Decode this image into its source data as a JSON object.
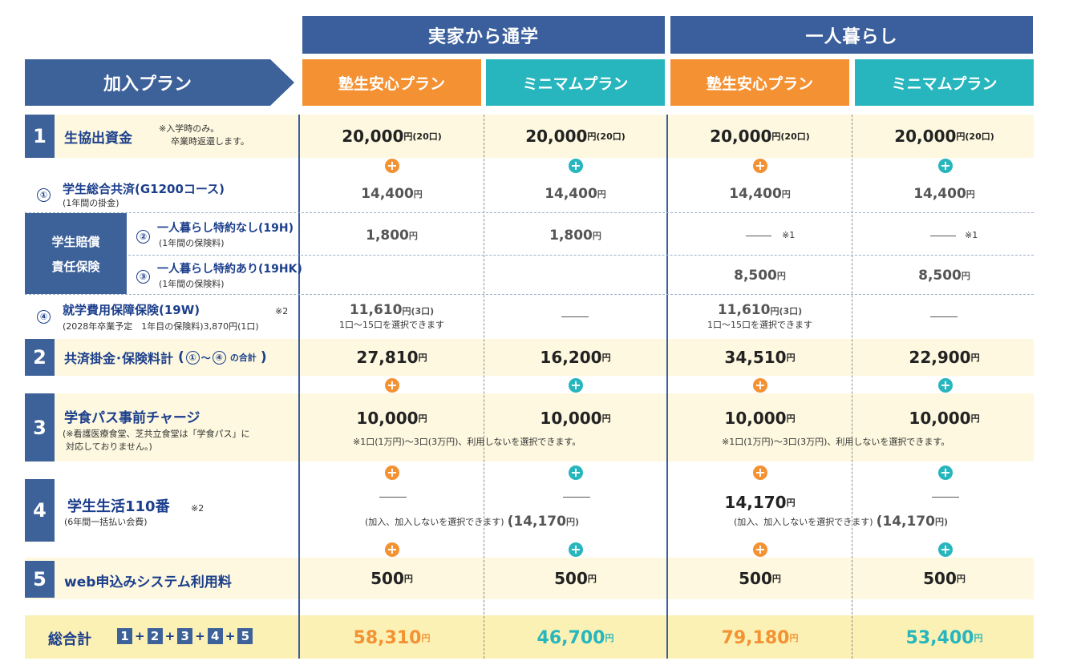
{
  "header": {
    "group_home": "実家から通学",
    "group_alone": "一人暮らし",
    "plan_label": "加入プラン",
    "cols": [
      "塾生安心プラン",
      "ミニマムプラン",
      "塾生安心プラン",
      "ミニマムプラン"
    ]
  },
  "rows": {
    "r1": {
      "num": "1",
      "title": "生協出資金",
      "note1": "※入学時のみ。",
      "note2": "卒業時返還します。",
      "vals": [
        "20,000",
        "20,000",
        "20,000",
        "20,000"
      ],
      "unit": "円",
      "sub": "(20口)"
    },
    "kyosai": {
      "circle": "①",
      "title": "学生総合共済(G1200コース)",
      "sub": "(1年間の掛金)",
      "vals": [
        "14,400",
        "14,400",
        "14,400",
        "14,400"
      ],
      "unit": "円"
    },
    "baisho": {
      "label1": "学生賠償",
      "label2": "責任保険",
      "a": {
        "circle": "②",
        "title": "一人暮らし特約なし(19H)",
        "sub": "(1年間の保険料)",
        "vals": [
          "1,800",
          "1,800"
        ],
        "unit": "円",
        "mark": "※1"
      },
      "b": {
        "circle": "③",
        "title": "一人暮らし特約あり(19HK)",
        "sub": "(1年間の保険料)",
        "vals": [
          "8,500",
          "8,500"
        ],
        "unit": "円"
      }
    },
    "shugaku": {
      "circle": "④",
      "title": "就学費用保障保険(19W)",
      "mark": "※2",
      "sub": "(2028年卒業予定　1年目の保険料)3,870円(1口)",
      "val": "11,610",
      "unit": "円",
      "units_sub": "(3口)",
      "note": "1口～15口を選択できます"
    },
    "r2": {
      "num": "2",
      "title": "共済掛金･保険料計",
      "paren_open": "(",
      "c1": "①",
      "tilde": "～",
      "c4": "④",
      "tail": "の合計",
      "paren_close": ")",
      "vals": [
        "27,810",
        "16,200",
        "34,510",
        "22,900"
      ],
      "unit": "円"
    },
    "r3": {
      "num": "3",
      "title": "学食パス事前チャージ",
      "note1": "(※看護医療食堂、芝共立食堂は「学食パス」に",
      "note2": "対応しておりません。)",
      "vals": [
        "10,000",
        "10,000",
        "10,000",
        "10,000"
      ],
      "unit": "円",
      "note": "※1口(1万円)～3口(3万円)、利用しないを選択できます。"
    },
    "r4": {
      "num": "4",
      "title": "学生生活110番",
      "mark": "※2",
      "sub": "(6年間一括払い会費)",
      "val": "14,170",
      "unit": "円",
      "note": "(加入、加入しないを選択できます)",
      "paren_val": "(14,170",
      "paren_unit": "円)"
    },
    "r5": {
      "num": "5",
      "title": "web申込みシステム利用料",
      "vals": [
        "500",
        "500",
        "500",
        "500"
      ],
      "unit": "円"
    }
  },
  "total": {
    "label": "総合計",
    "n": [
      "1",
      "2",
      "3",
      "4",
      "5"
    ],
    "plus": "+",
    "vals": [
      "58,310",
      "46,700",
      "79,180",
      "53,400"
    ],
    "unit": "円"
  },
  "colors": {
    "navy": "#3a5f9c",
    "orange": "#f49233",
    "teal": "#27b6bd",
    "cream": "#fdf8df",
    "total_bg": "#fbf1b4"
  }
}
